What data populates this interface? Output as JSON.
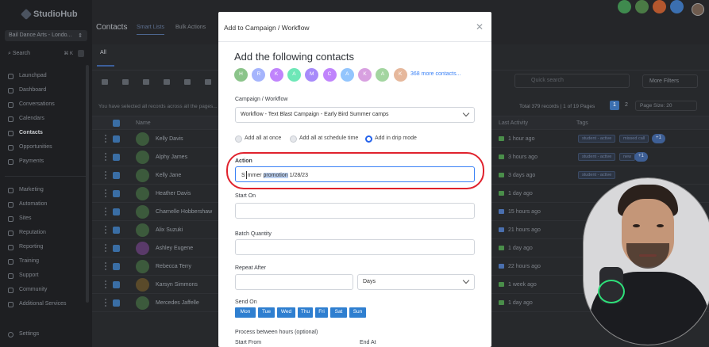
{
  "app": {
    "logo": "StudioHub",
    "account": "Bail Dance Arts - Londo...",
    "search_placeholder": "Search",
    "search_shortcut": "⌘ K"
  },
  "sidebar": {
    "items": [
      {
        "label": "Launchpad"
      },
      {
        "label": "Dashboard"
      },
      {
        "label": "Conversations"
      },
      {
        "label": "Calendars"
      },
      {
        "label": "Contacts"
      },
      {
        "label": "Opportunities"
      },
      {
        "label": "Payments"
      },
      {
        "label": "Marketing"
      },
      {
        "label": "Automation"
      },
      {
        "label": "Sites"
      },
      {
        "label": "Reputation"
      },
      {
        "label": "Reporting"
      },
      {
        "label": "Training"
      },
      {
        "label": "Support"
      },
      {
        "label": "Community"
      },
      {
        "label": "Additional Services"
      }
    ],
    "settings": "Settings"
  },
  "header": {
    "title": "Contacts",
    "tabs": [
      {
        "label": "Smart Lists"
      },
      {
        "label": "Bulk Actions"
      }
    ]
  },
  "main": {
    "all_tab": "All",
    "search_placeholder": "Quick search",
    "more_filters": "More Filters",
    "selection_info": "You have selected all records across all the pages...",
    "total_info": "Total 379 records | 1 of 19 Pages",
    "pages": [
      "1",
      "2"
    ],
    "page_size": "Page Size: 20",
    "columns": {
      "name": "Name",
      "last_activity": "Last Activity",
      "tags": "Tags"
    },
    "rows": [
      {
        "name": "Kelly Davis",
        "activity": "1 hour ago"
      },
      {
        "name": "Alphy James",
        "activity": "3 hours ago"
      },
      {
        "name": "Kelly Jane",
        "activity": "3 days ago"
      },
      {
        "name": "Heather Davis",
        "activity": "1 day ago"
      },
      {
        "name": "Charnelle Hobbershaw",
        "activity": "15 hours ago"
      },
      {
        "name": "Alix Suzuki",
        "activity": "21 hours ago"
      },
      {
        "name": "Ashley Eugene",
        "activity": "1 day ago"
      },
      {
        "name": "Rebecca Terry",
        "activity": "22 hours ago"
      },
      {
        "name": "Karsyn Simmons",
        "activity": "1 week ago"
      },
      {
        "name": "Mercedes Jaffelle",
        "activity": "1 day ago"
      }
    ],
    "tags": [
      "student - active",
      "missed call",
      "+1",
      "new"
    ]
  },
  "modal": {
    "title": "Add to Campaign / Workflow",
    "heading": "Add the following contacts",
    "chips": [
      "H",
      "R",
      "K",
      "A",
      "M",
      "C",
      "A",
      "K",
      "A",
      "K"
    ],
    "chip_colors": [
      "#8bc48a",
      "#a5b4fc",
      "#c084fc",
      "#6ee7b7",
      "#a78bfa",
      "#c084fc",
      "#93c5fd",
      "#d8a0e0",
      "#a3d5a0",
      "#e6b89c"
    ],
    "more_contacts": "368 more contacts...",
    "campaign_label": "Campaign / Workflow",
    "campaign_value": "Workflow - Text Blast Campaign - Early Bird Summer camps",
    "radio": [
      {
        "label": "Add all at once"
      },
      {
        "label": "Add all at schedule time"
      },
      {
        "label": "Add in drip mode"
      }
    ],
    "action_label": "Action",
    "action_value_pre": "S",
    "action_value_mid": "mmer",
    "action_value_hl": "promotion",
    "action_value_post": " 1/28/23",
    "start_on_label": "Start On",
    "batch_label": "Batch Quantity",
    "repeat_label": "Repeat After",
    "repeat_unit": "Days",
    "send_on_label": "Send On",
    "days": [
      "Mon",
      "Tue",
      "Wed",
      "Thu",
      "Fri",
      "Sat",
      "Sun"
    ],
    "process_label": "Process between hours (optional)",
    "start_from_label": "Start From",
    "end_at_label": "End At"
  }
}
